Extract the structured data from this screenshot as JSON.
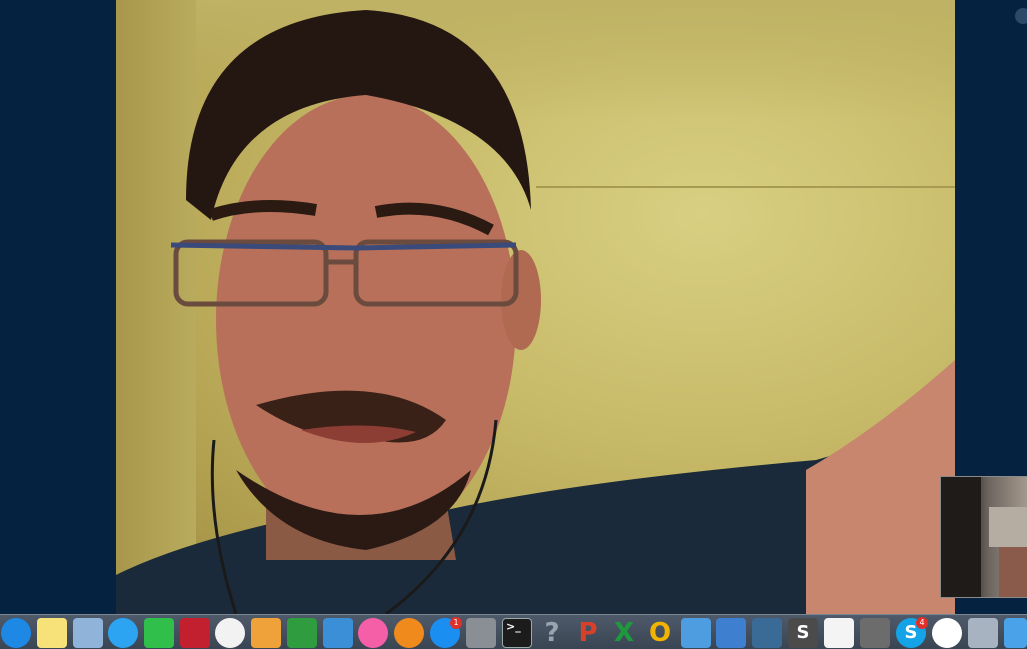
{
  "app": {
    "title": ""
  },
  "video": {
    "remote_feed": "remote-participant-video",
    "self_view": "self-view-video"
  },
  "dock": {
    "apps": [
      {
        "name": "safari-icon",
        "glyph": "",
        "color": "#1e88e5"
      },
      {
        "name": "notes-icon",
        "glyph": "",
        "color": "#f7e27a"
      },
      {
        "name": "preview-icon",
        "glyph": "",
        "color": "#8fb3d9"
      },
      {
        "name": "messages-icon",
        "glyph": "",
        "color": "#2da4f2"
      },
      {
        "name": "facetime-icon",
        "glyph": "",
        "color": "#2fbf4a"
      },
      {
        "name": "photo-booth-icon",
        "glyph": "",
        "color": "#c2202e"
      },
      {
        "name": "photos-icon",
        "glyph": "",
        "color": "#f2f2f2"
      },
      {
        "name": "pages-icon",
        "glyph": "",
        "color": "#f0a23a"
      },
      {
        "name": "numbers-icon",
        "glyph": "",
        "color": "#2f9c3f"
      },
      {
        "name": "keynote-icon",
        "glyph": "",
        "color": "#3b8fd6"
      },
      {
        "name": "itunes-icon",
        "glyph": "",
        "color": "#f45fa8"
      },
      {
        "name": "ibooks-icon",
        "glyph": "",
        "color": "#f08a1c"
      },
      {
        "name": "app-store-icon",
        "glyph": "",
        "color": "#1b8ef2"
      },
      {
        "name": "system-preferences-icon",
        "glyph": "",
        "color": "#8a8f95"
      },
      {
        "name": "terminal-icon",
        "glyph": ">_",
        "color": "#1c1c1c"
      },
      {
        "name": "unknown-app-icon",
        "glyph": "?",
        "color": "transparent"
      },
      {
        "name": "powerpoint-icon",
        "glyph": "P",
        "color": "transparent"
      },
      {
        "name": "excel-icon",
        "glyph": "X",
        "color": "transparent"
      },
      {
        "name": "outlook-icon",
        "glyph": "O",
        "color": "transparent"
      },
      {
        "name": "downloads-icon",
        "glyph": "",
        "color": "#4d9de0"
      },
      {
        "name": "xcode-icon",
        "glyph": "",
        "color": "#3f7fd0"
      },
      {
        "name": "postgres-icon",
        "glyph": "",
        "color": "#3a6b96"
      },
      {
        "name": "sublime-text-icon",
        "glyph": "S",
        "color": "#4b4b4b"
      },
      {
        "name": "textedit-icon",
        "glyph": "",
        "color": "#f4f4f4"
      },
      {
        "name": "calculator-icon",
        "glyph": "",
        "color": "#6c6c6c"
      },
      {
        "name": "skype-icon",
        "glyph": "S",
        "color": "#14a3e6"
      },
      {
        "name": "chrome-icon",
        "glyph": "",
        "color": "#ffffff"
      },
      {
        "name": "image-capture-icon",
        "glyph": "",
        "color": "#a7b3c0"
      },
      {
        "name": "downloads-folder-icon",
        "glyph": "",
        "color": "#4aa3e8"
      }
    ],
    "badges": {
      "app_store": "1",
      "skype": "4"
    }
  }
}
